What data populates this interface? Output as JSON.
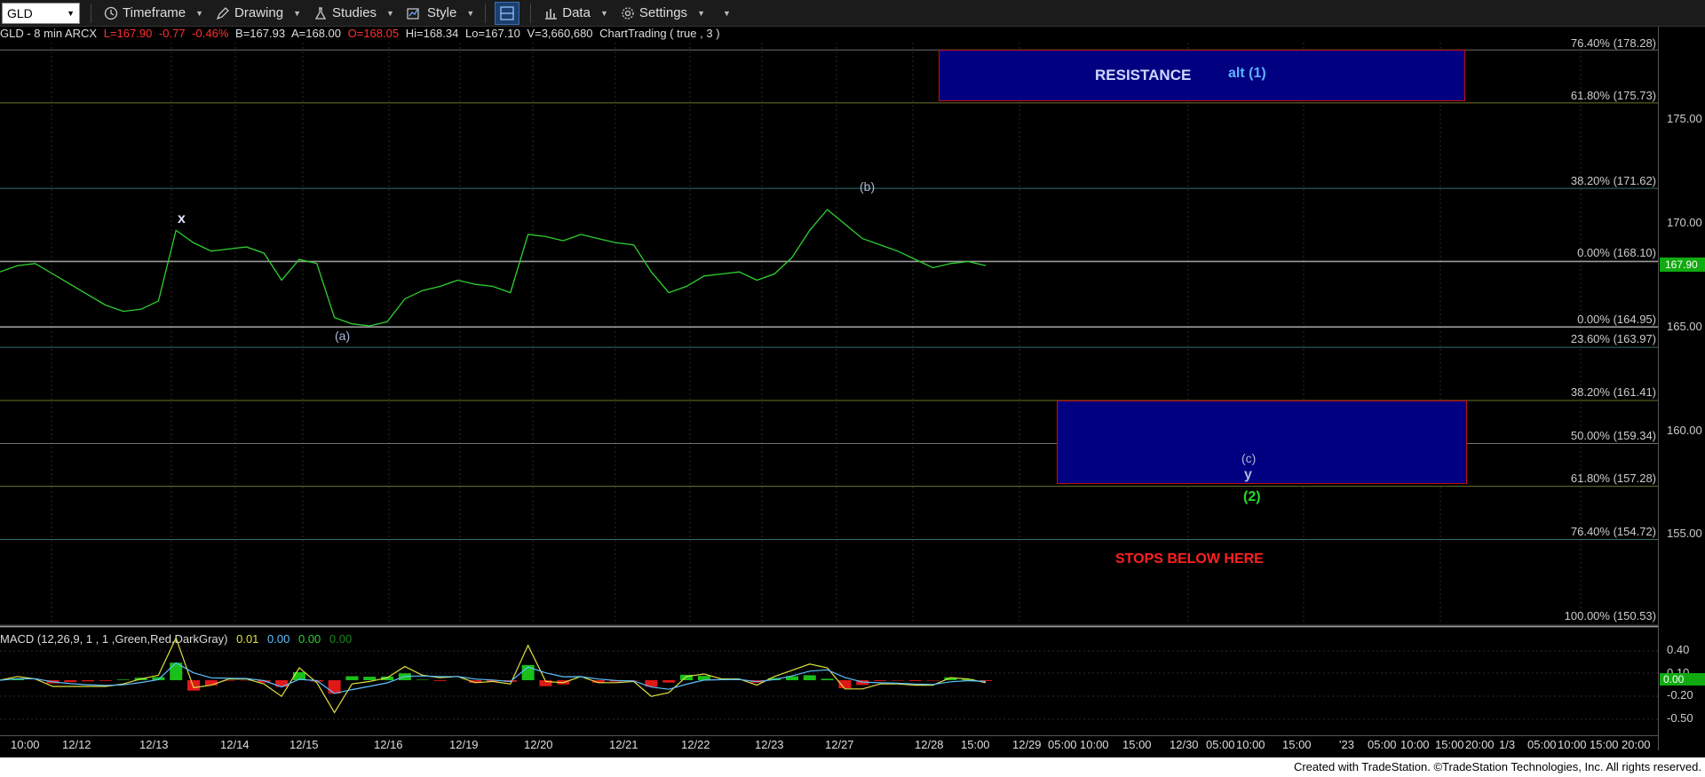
{
  "toolbar": {
    "symbol": "GLD",
    "items": [
      {
        "label": "Timeframe",
        "icon": "clock-icon"
      },
      {
        "label": "Drawing",
        "icon": "pencil-icon"
      },
      {
        "label": "Studies",
        "icon": "flask-icon"
      },
      {
        "label": "Style",
        "icon": "chart-style-icon"
      },
      {
        "label": "Data",
        "icon": "bar-chart-icon"
      },
      {
        "label": "Settings",
        "icon": "gear-icon"
      }
    ]
  },
  "header": {
    "symbol_info": "GLD - 8 min  ARCX",
    "last": "L=167.90",
    "change": "-0.77",
    "change_pct": "-0.46%",
    "bid": "B=167.93",
    "ask": "A=168.00",
    "open": "O=168.05",
    "high": "Hi=168.34",
    "low": "Lo=167.10",
    "volume": "V=3,660,680",
    "study": "ChartTrading ( true , 3 )"
  },
  "price_axis": {
    "ticks": [
      "175.00",
      "170.00",
      "165.00",
      "160.00",
      "155.00"
    ],
    "last_price": "167.90"
  },
  "fib_levels": [
    {
      "label": "76.40% (178.28)",
      "color": "#9a9a9a"
    },
    {
      "label": "61.80% (175.73)",
      "color": "#a0a040"
    },
    {
      "label": "38.20% (171.62)",
      "color": "#4aa0a0"
    },
    {
      "label": "0.00% (168.10)",
      "color": "#dddddd"
    },
    {
      "label": "0.00% (164.95)",
      "color": "#dddddd"
    },
    {
      "label": "23.60% (163.97)",
      "color": "#4aa0a0"
    },
    {
      "label": "38.20% (161.41)",
      "color": "#a0a040"
    },
    {
      "label": "50.00% (159.34)",
      "color": "#a0a0a0"
    },
    {
      "label": "61.80% (157.28)",
      "color": "#a0a040"
    },
    {
      "label": "76.40% (154.72)",
      "color": "#4aa0a0"
    },
    {
      "label": "100.00% (150.53)",
      "color": "#dddddd"
    }
  ],
  "annotations": {
    "resistance": "RESISTANCE",
    "alt": "alt (1)",
    "x": "x",
    "a": "(a)",
    "b": "(b)",
    "c": "(c)",
    "y": "y",
    "two": "(2)",
    "stops": "STOPS BELOW HERE"
  },
  "macd": {
    "title": "MACD (12,26,9, 1 , 1 ,Green,Red,DarkGray)",
    "v1": "0.01",
    "v2": "0.00",
    "v3": "0.00",
    "v4": "0.00",
    "ticks": [
      "0.40",
      "0.10",
      "-0.20",
      "-0.50"
    ],
    "last": "0.00"
  },
  "x_axis": {
    "labels": [
      "10:00",
      "12/12",
      "12/13",
      "12/14",
      "12/15",
      "12/16",
      "12/19",
      "12/20",
      "12/21",
      "12/22",
      "12/23",
      "12/27",
      "12/28",
      "15:00",
      "12/29",
      "05:00",
      "10:00",
      "15:00",
      "12/30",
      "05:00",
      "10:00",
      "15:00",
      "'23",
      "05:00",
      "10:00",
      "15:00",
      "20:00",
      "1/3",
      "05:00",
      "10:00",
      "15:00",
      "20:00"
    ]
  },
  "footer": "Created with TradeStation. ©TradeStation Technologies, Inc. All rights reserved.",
  "chart_data": {
    "type": "line",
    "title": "GLD - 8 min",
    "ylim": [
      149.5,
      180.0
    ],
    "series": [
      {
        "values": [
          167.6,
          167.9,
          168.0,
          167.5,
          167.0,
          166.5,
          166.0,
          165.7,
          165.8,
          166.2,
          169.6,
          169.0,
          168.6,
          168.7,
          168.8,
          168.5,
          167.2,
          168.2,
          168.0,
          165.4,
          165.1,
          165.0,
          165.2,
          166.3,
          166.7,
          166.9,
          167.2,
          167.0,
          166.9,
          166.6,
          169.4,
          169.3,
          169.1,
          169.4,
          169.2,
          169.0,
          168.9,
          167.6,
          166.6,
          166.9,
          167.4,
          167.5,
          167.6,
          167.2,
          167.5,
          168.3,
          169.6,
          170.6,
          169.9,
          169.2,
          168.9,
          168.6,
          168.2,
          167.8,
          168.0,
          168.1,
          167.9
        ]
      }
    ],
    "fib_lines": [
      178.28,
      175.73,
      171.62,
      168.1,
      164.95,
      163.97,
      161.41,
      159.34,
      157.28,
      154.72,
      150.53
    ],
    "zones": [
      {
        "label": "RESISTANCE alt (1)",
        "from": 175.73,
        "to": 180.0
      },
      {
        "label": "(c) y (2)",
        "from": 157.28,
        "to": 161.41
      }
    ]
  }
}
